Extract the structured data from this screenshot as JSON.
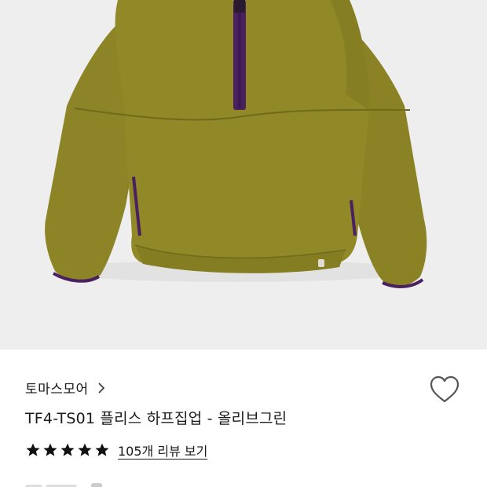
{
  "hero_image": {
    "subject": "olive fleece half-zip pullover",
    "background_color": "#eeeeee",
    "fleece_color": "#8e8526",
    "trim_color": "#4a2160"
  },
  "product": {
    "brand": "토마스모어",
    "name": "TF4-TS01 플리스 하프집업 - 올리브그린",
    "rating_stars": 5,
    "review_link": "105개 리뷰 보기"
  },
  "icons": {
    "brand_chevron": "chevron-right-icon",
    "wishlist": "heart-outline-icon",
    "star": "star-filled-icon"
  },
  "colors": {
    "text": "#1a1a1a",
    "star": "#111111",
    "heart_stroke": "#555555"
  }
}
